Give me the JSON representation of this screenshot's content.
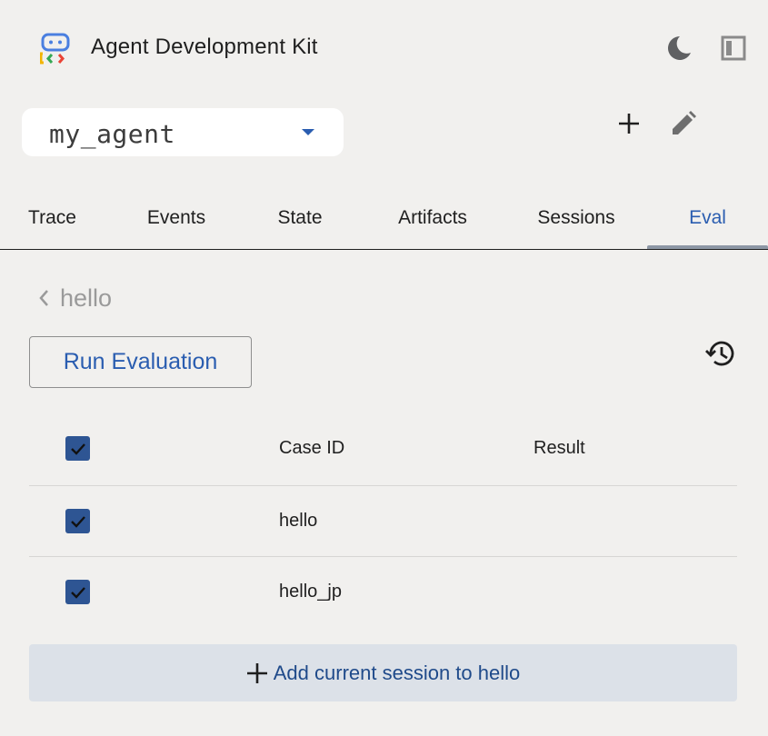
{
  "header": {
    "title": "Agent Development Kit",
    "logo_icon": "adk-logo-icon",
    "theme_icon": "moon-icon",
    "sidebar_icon": "sidebar-collapse-icon"
  },
  "agent_selector": {
    "value": "my_agent",
    "icon": "dropdown-caret-icon"
  },
  "toolbar": {
    "new_session_icon": "plus-icon",
    "edit_icon": "pencil-icon"
  },
  "tabs": [
    {
      "label": "Trace"
    },
    {
      "label": "Events"
    },
    {
      "label": "State"
    },
    {
      "label": "Artifacts"
    },
    {
      "label": "Sessions"
    },
    {
      "label": "Eval",
      "active": true
    }
  ],
  "eval_set": {
    "back_icon": "chevron-left-icon",
    "name": "hello",
    "run_label": "Run Evaluation",
    "history_icon": "history-icon"
  },
  "table": {
    "columns": [
      "Case ID",
      "Result"
    ],
    "rows": [
      {
        "case_id": "hello",
        "result": "",
        "checked": true
      },
      {
        "case_id": "hello_jp",
        "result": "",
        "checked": true
      }
    ]
  },
  "add_session": {
    "label": "Add current session to hello",
    "icon": "plus-icon"
  },
  "colors": {
    "accent": "#2a5db0",
    "checkbox": "#2e5593",
    "background": "#f1f0ee",
    "add_button_bg": "#dce1e8"
  }
}
